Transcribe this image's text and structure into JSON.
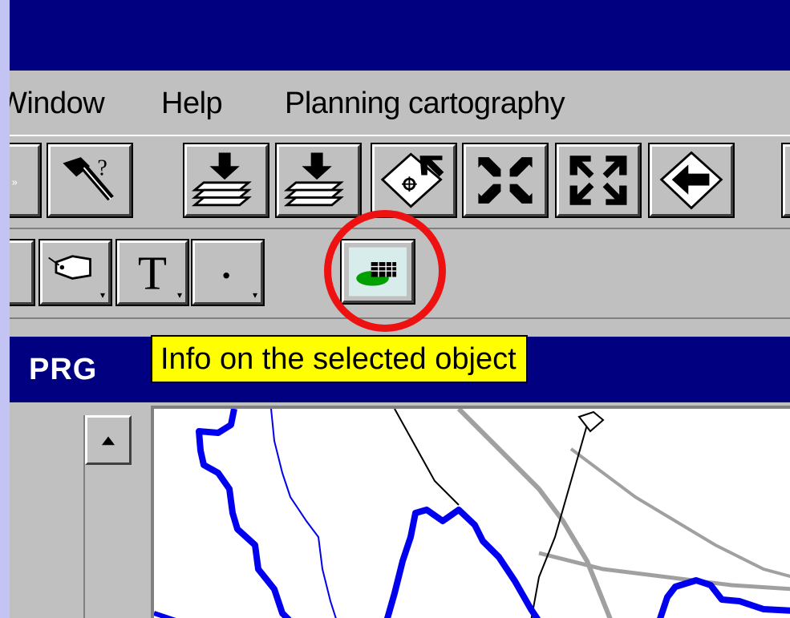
{
  "menu": {
    "window_label": "Window",
    "help_label": "Help",
    "planning_label": "Planning cartography"
  },
  "toolbar_top": {
    "buttons": [
      "partial-button-icon",
      "hammer-help-icon",
      "load-layer-icon",
      "load-layer-edit-icon",
      "zoom-to-selection-icon",
      "zoom-in-icon",
      "zoom-extent-icon",
      "pan-back-icon"
    ]
  },
  "toolbar_bottom": {
    "buttons": [
      "polyline-tool-icon",
      "label-tag-icon",
      "text-tool-icon",
      "point-tool-icon",
      "info-selected-object-icon"
    ]
  },
  "tooltip": {
    "text": "Info on the selected object"
  },
  "document": {
    "title": "PRG"
  },
  "colors": {
    "titlebar": "#000080",
    "tooltip_bg": "#ffff00",
    "highlight": "#ee1111",
    "map_boundary": "#0000ee",
    "map_road": "#a0a0a0"
  }
}
